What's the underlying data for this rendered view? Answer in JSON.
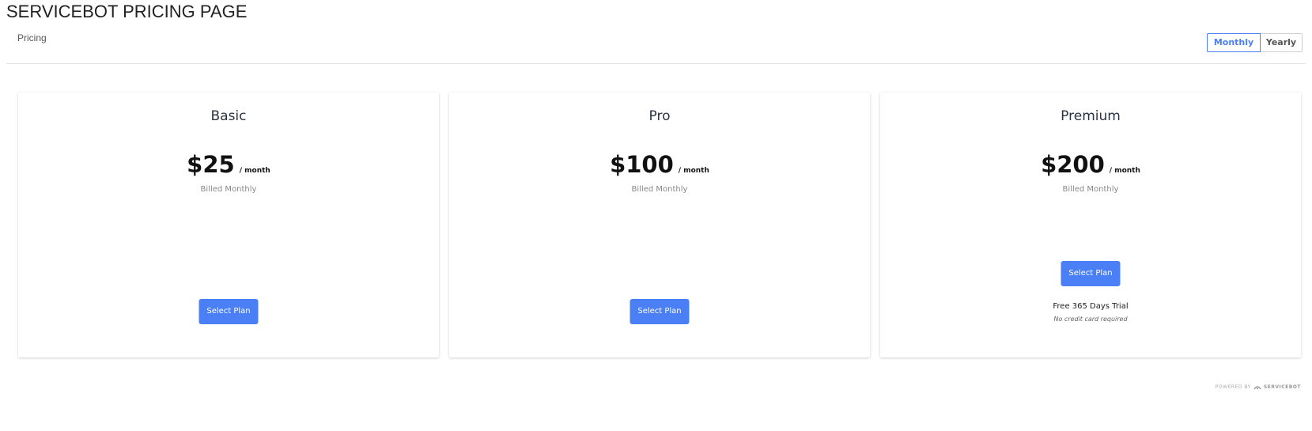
{
  "header": {
    "title": "SERVICEBOT PRICING PAGE",
    "tab": "Pricing"
  },
  "billing_toggle": {
    "options": [
      "Monthly",
      "Yearly"
    ],
    "selected": "Monthly"
  },
  "plans": [
    {
      "name": "Basic",
      "price": "$25",
      "period": "/ month",
      "billed": "Billed Monthly",
      "button": "Select Plan"
    },
    {
      "name": "Pro",
      "price": "$100",
      "period": "/ month",
      "billed": "Billed Monthly",
      "button": "Select Plan"
    },
    {
      "name": "Premium",
      "price": "$200",
      "period": "/ month",
      "billed": "Billed Monthly",
      "button": "Select Plan",
      "trial": "Free 365 Days Trial",
      "trial_note": "No credit card required"
    }
  ],
  "footer": {
    "powered_by": "POWERED BY",
    "brand": "SERVICEBOT",
    "logo_icon": "servicebot-logo-icon"
  },
  "colors": {
    "accent": "#4a7ff5",
    "text_dark": "#2b3242",
    "muted": "#888888"
  }
}
